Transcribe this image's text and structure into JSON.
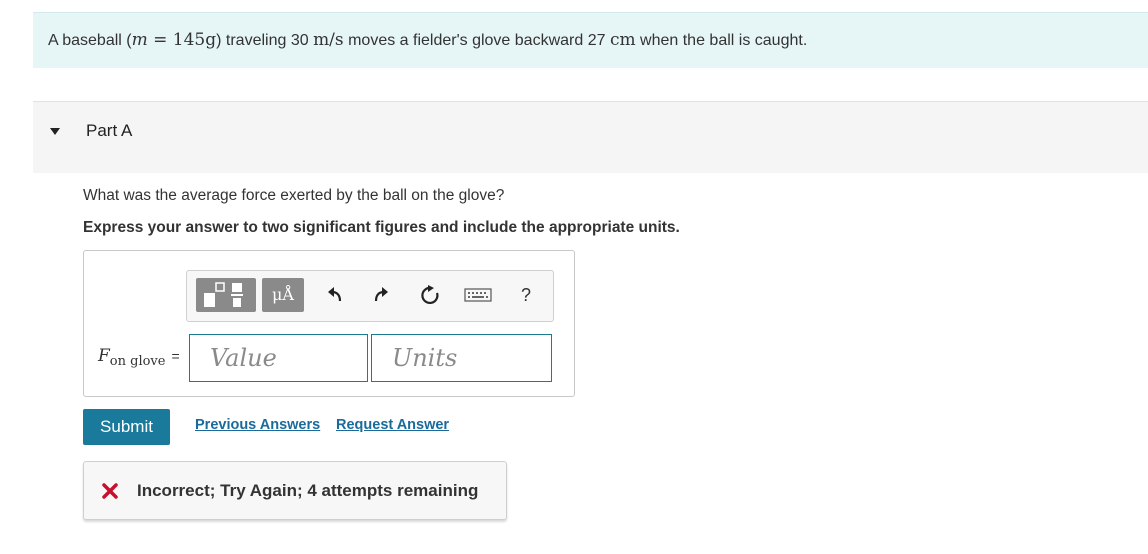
{
  "problem": {
    "text_before": "A baseball (",
    "math_m": "m",
    "math_eq": " = 145g",
    "text_mid": ") traveling 30 ",
    "speed_unit": "m/s",
    "text_after": " moves a fielder's glove backward 27 ",
    "dist_unit": "cm",
    "text_end": " when the ball is caught."
  },
  "part": {
    "label": "Part A"
  },
  "question": "What was the average force exerted by the ball on the glove?",
  "instructions": "Express your answer to two significant figures and include the appropriate units.",
  "toolbar": {
    "units_label": "μÅ",
    "help_label": "?",
    "icons": [
      "templates-icon",
      "units-icon",
      "undo-icon",
      "redo-icon",
      "reset-icon",
      "keyboard-icon",
      "help-icon"
    ]
  },
  "answer": {
    "label_var": "F",
    "label_sub": "on glove",
    "label_eq": "=",
    "value_placeholder": "Value",
    "units_placeholder": "Units"
  },
  "actions": {
    "submit": "Submit",
    "previous_answers": "Previous Answers",
    "request_answer": "Request Answer"
  },
  "feedback": {
    "text": "Incorrect; Try Again; 4 attempts remaining",
    "error_color": "#c8102e"
  },
  "colors": {
    "problem_bg": "#e6f5f6",
    "accent": "#1a7a9b",
    "link": "#1a6b9b"
  }
}
